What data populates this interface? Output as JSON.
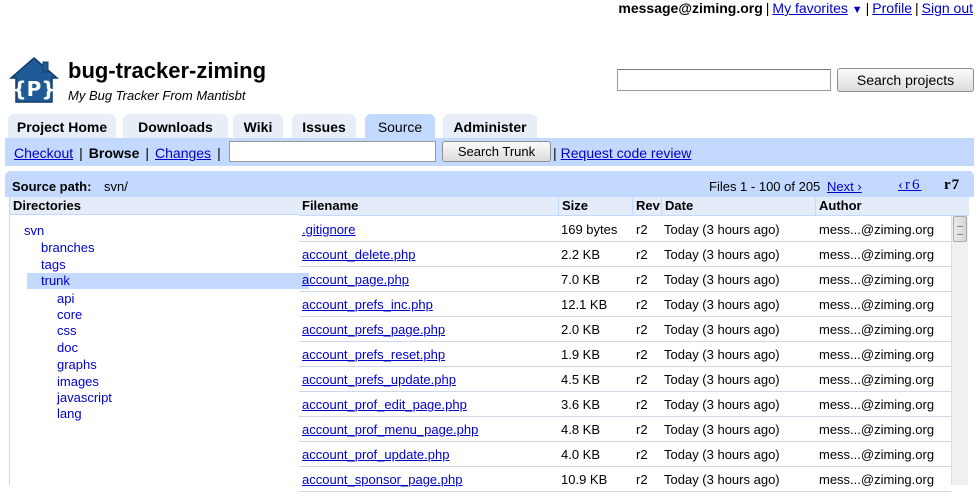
{
  "account": {
    "email": "message@ziming.org",
    "favorites_label": "My favorites",
    "favorites_arrow": "▼",
    "profile_label": "Profile",
    "signout_label": "Sign out"
  },
  "project": {
    "name": "bug-tracker-ziming",
    "summary": "My Bug Tracker From Mantisbt",
    "logo_icon": "house-p-icon"
  },
  "project_search": {
    "value": "",
    "button_label": "Search projects"
  },
  "tabs": [
    {
      "label": "Project Home"
    },
    {
      "label": "Downloads"
    },
    {
      "label": "Wiki"
    },
    {
      "label": "Issues"
    },
    {
      "label": "Source"
    },
    {
      "label": "Administer"
    }
  ],
  "subnav": {
    "checkout": "Checkout",
    "browse": "Browse",
    "changes": "Changes",
    "search_value": "",
    "search_button": "Search Trunk",
    "review_label": "Request code review"
  },
  "pathbar": {
    "label": "Source path:",
    "path": "svn/",
    "count": "Files 1 - 100 of 205",
    "next": "Next ›",
    "prev_rev": "‹r6",
    "cur_rev": "r7"
  },
  "directories": {
    "header": "Directories",
    "items": [
      "svn",
      "branches",
      "tags",
      "trunk",
      "api",
      "core",
      "css",
      "doc",
      "graphs",
      "images",
      "javascript",
      "lang"
    ],
    "selected": "trunk"
  },
  "files": {
    "headers": {
      "filename": "Filename",
      "size": "Size",
      "rev": "Rev",
      "date": "Date",
      "author": "Author"
    },
    "rows": [
      {
        "name": ".gitignore",
        "size": "169 bytes",
        "rev": "r2",
        "date": "Today (3 hours ago)",
        "author": "mess...@ziming.org"
      },
      {
        "name": "account_delete.php",
        "size": "2.2 KB",
        "rev": "r2",
        "date": "Today (3 hours ago)",
        "author": "mess...@ziming.org"
      },
      {
        "name": "account_page.php",
        "size": "7.0 KB",
        "rev": "r2",
        "date": "Today (3 hours ago)",
        "author": "mess...@ziming.org"
      },
      {
        "name": "account_prefs_inc.php",
        "size": "12.1 KB",
        "rev": "r2",
        "date": "Today (3 hours ago)",
        "author": "mess...@ziming.org"
      },
      {
        "name": "account_prefs_page.php",
        "size": "2.0 KB",
        "rev": "r2",
        "date": "Today (3 hours ago)",
        "author": "mess...@ziming.org"
      },
      {
        "name": "account_prefs_reset.php",
        "size": "1.9 KB",
        "rev": "r2",
        "date": "Today (3 hours ago)",
        "author": "mess...@ziming.org"
      },
      {
        "name": "account_prefs_update.php",
        "size": "4.5 KB",
        "rev": "r2",
        "date": "Today (3 hours ago)",
        "author": "mess...@ziming.org"
      },
      {
        "name": "account_prof_edit_page.php",
        "size": "3.6 KB",
        "rev": "r2",
        "date": "Today (3 hours ago)",
        "author": "mess...@ziming.org"
      },
      {
        "name": "account_prof_menu_page.php",
        "size": "4.8 KB",
        "rev": "r2",
        "date": "Today (3 hours ago)",
        "author": "mess...@ziming.org"
      },
      {
        "name": "account_prof_update.php",
        "size": "4.0 KB",
        "rev": "r2",
        "date": "Today (3 hours ago)",
        "author": "mess...@ziming.org"
      },
      {
        "name": "account_sponsor_page.php",
        "size": "10.9 KB",
        "rev": "r2",
        "date": "Today (3 hours ago)",
        "author": "mess...@ziming.org"
      }
    ]
  },
  "colors": {
    "tab_bg": "#c3d9ff",
    "header_bg": "#e5ecf9",
    "link": "#0000cc"
  }
}
